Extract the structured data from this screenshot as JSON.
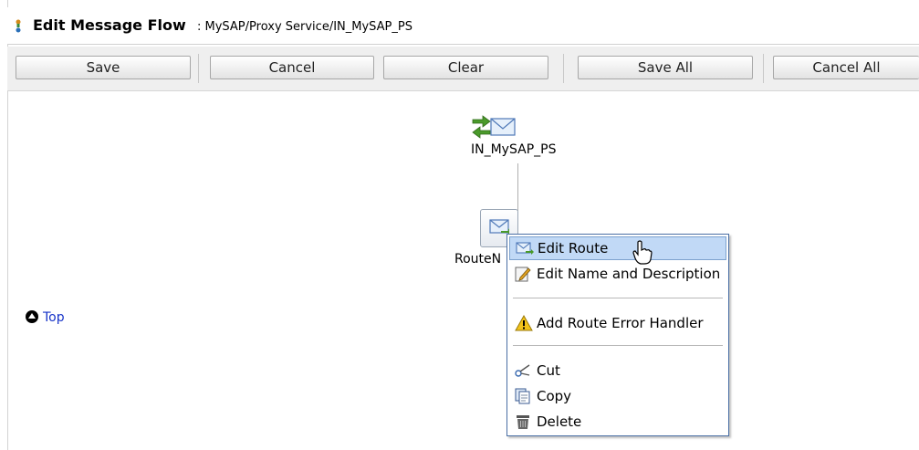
{
  "header": {
    "title": "Edit Message Flow",
    "path": ": MySAP/Proxy Service/IN_MySAP_PS"
  },
  "toolbar": {
    "save": "Save",
    "cancel": "Cancel",
    "clear": "Clear",
    "save_all": "Save All",
    "cancel_all": "Cancel All"
  },
  "flow": {
    "proxy_node_label": "IN_MySAP_PS",
    "route_node_label": "RouteN"
  },
  "top_link": "Top",
  "context_menu": {
    "items": [
      {
        "label": "Edit Route",
        "icon": "edit-route-icon"
      },
      {
        "label": "Edit Name and Description",
        "icon": "edit-name-icon"
      },
      {
        "label": "Add Route Error Handler",
        "icon": "warning-icon"
      },
      {
        "label": "Cut",
        "icon": "scissors-icon"
      },
      {
        "label": "Copy",
        "icon": "copy-icon"
      },
      {
        "label": "Delete",
        "icon": "trash-icon"
      }
    ]
  }
}
